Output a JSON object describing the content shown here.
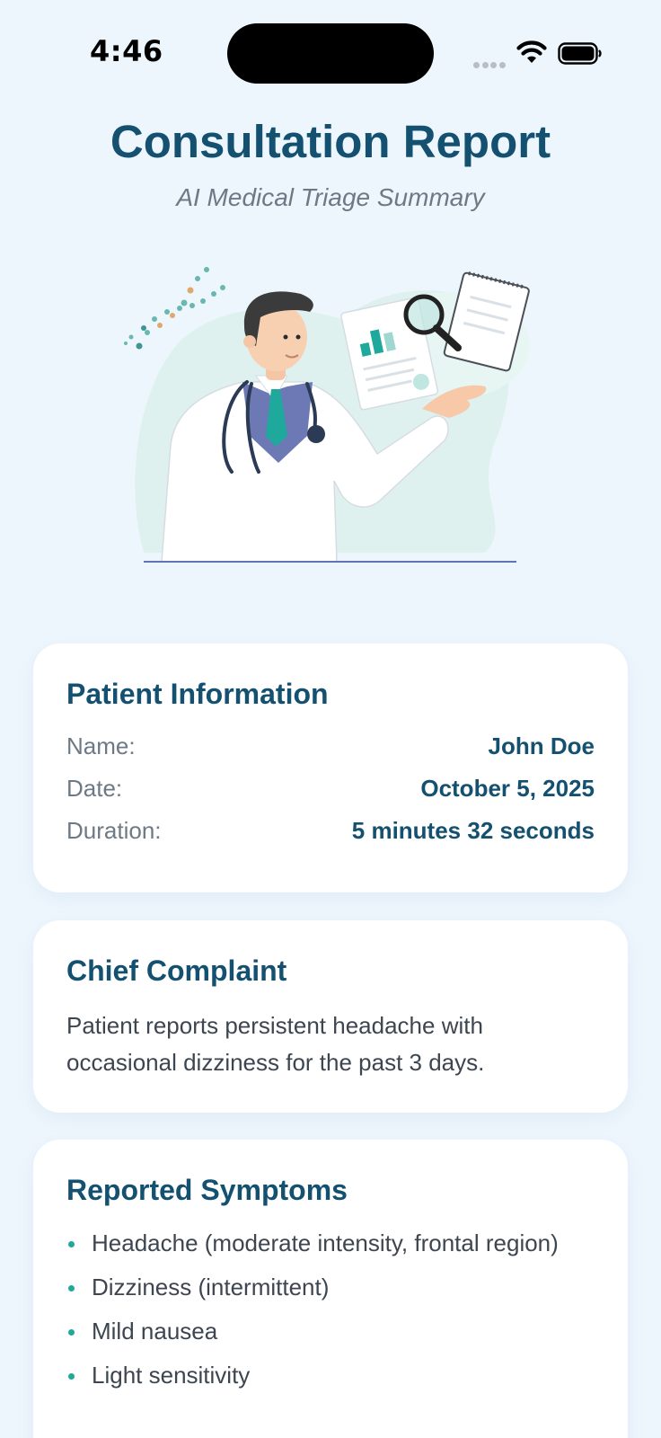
{
  "status_bar": {
    "time": "4:46"
  },
  "header": {
    "title": "Consultation Report",
    "subtitle": "AI Medical Triage Summary"
  },
  "illustration": {
    "icon": "doctor-with-report-illustration"
  },
  "patient_info": {
    "title": "Patient Information",
    "rows": [
      {
        "label": "Name:",
        "value": "John Doe"
      },
      {
        "label": "Date:",
        "value": "October 5, 2025"
      },
      {
        "label": "Duration:",
        "value": "5 minutes 32 seconds"
      }
    ]
  },
  "chief_complaint": {
    "title": "Chief Complaint",
    "text": "Patient reports persistent headache with occasional dizziness for the past 3 days."
  },
  "symptoms": {
    "title": "Reported Symptoms",
    "items": [
      "Headache (moderate intensity, frontal region)",
      "Dizziness (intermittent)",
      "Mild nausea",
      "Light sensitivity"
    ]
  },
  "colors": {
    "background": "#eef6fd",
    "heading": "#14506f",
    "accent": "#1fa99c",
    "muted": "#6d7985"
  }
}
